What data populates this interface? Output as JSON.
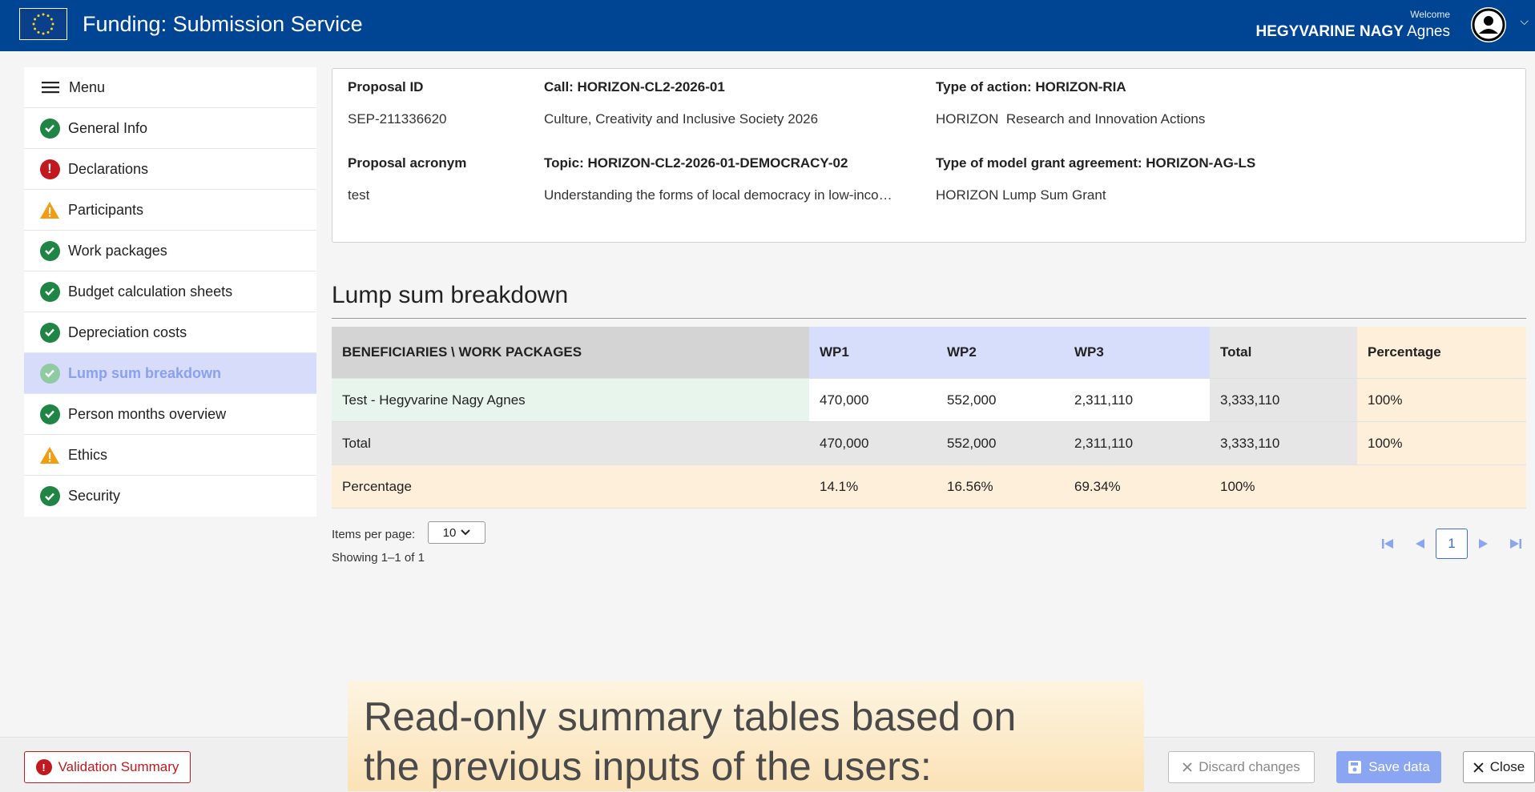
{
  "header": {
    "title": "Funding: Submission Service",
    "welcome": "Welcome",
    "user_last": "HEGYVARINE NAGY",
    "user_first": "Agnes"
  },
  "sidebar": {
    "menu_label": "Menu",
    "items": [
      {
        "label": "General Info",
        "status": "ok"
      },
      {
        "label": "Declarations",
        "status": "error"
      },
      {
        "label": "Participants",
        "status": "warning"
      },
      {
        "label": "Work packages",
        "status": "ok"
      },
      {
        "label": "Budget calculation sheets",
        "status": "ok"
      },
      {
        "label": "Depreciation costs",
        "status": "ok"
      },
      {
        "label": "Lump sum breakdown",
        "status": "ok",
        "active": true
      },
      {
        "label": "Person months overview",
        "status": "ok"
      },
      {
        "label": "Ethics",
        "status": "warning"
      },
      {
        "label": "Security",
        "status": "ok"
      }
    ]
  },
  "proposal": {
    "id_label": "Proposal ID",
    "id_value": "SEP-211336620",
    "call_label": "Call: HORIZON-CL2-2026-01",
    "call_value": "Culture, Creativity and Inclusive Society 2026",
    "action_label": "Type of action: HORIZON-RIA",
    "action_value": "HORIZON  Research and Innovation Actions",
    "acronym_label": "Proposal acronym",
    "acronym_value": "test",
    "topic_label": "Topic: HORIZON-CL2-2026-01-DEMOCRACY-02",
    "topic_value": "Understanding the forms of local democracy in low-inco…",
    "mga_label": "Type of model grant agreement: HORIZON-AG-LS",
    "mga_value": "HORIZON Lump Sum Grant"
  },
  "section": {
    "title": "Lump sum breakdown"
  },
  "table": {
    "headers": [
      "BENEFICIARIES \\ WORK PACKAGES",
      "WP1",
      "WP2",
      "WP3",
      "Total",
      "Percentage"
    ],
    "rows": [
      {
        "name": "Test - Hegyvarine Nagy Agnes",
        "wp1": "470,000",
        "wp2": "552,000",
        "wp3": "2,311,110",
        "total": "3,333,110",
        "pct": "100%"
      },
      {
        "name": "Total",
        "wp1": "470,000",
        "wp2": "552,000",
        "wp3": "2,311,110",
        "total": "3,333,110",
        "pct": "100%"
      },
      {
        "name": "Percentage",
        "wp1": "14.1%",
        "wp2": "16.56%",
        "wp3": "69.34%",
        "total": "100%",
        "pct": ""
      }
    ]
  },
  "pagination": {
    "items_per_page_label": "Items per page:",
    "items_per_page_value": "10",
    "showing": "Showing 1–1 of 1",
    "current_page": "1"
  },
  "footer": {
    "validation_label": "Validation Summary",
    "discard_label": "Discard changes",
    "save_label": "Save data",
    "close_label": "Close"
  },
  "caption": {
    "line1": "Read-only summary tables based on",
    "line2": "the previous inputs of the users:"
  },
  "colors": {
    "brand": "#004494",
    "ok": "#1f8545",
    "error": "#c1191f",
    "warning": "#f39c12",
    "accent": "#3b6de0"
  }
}
